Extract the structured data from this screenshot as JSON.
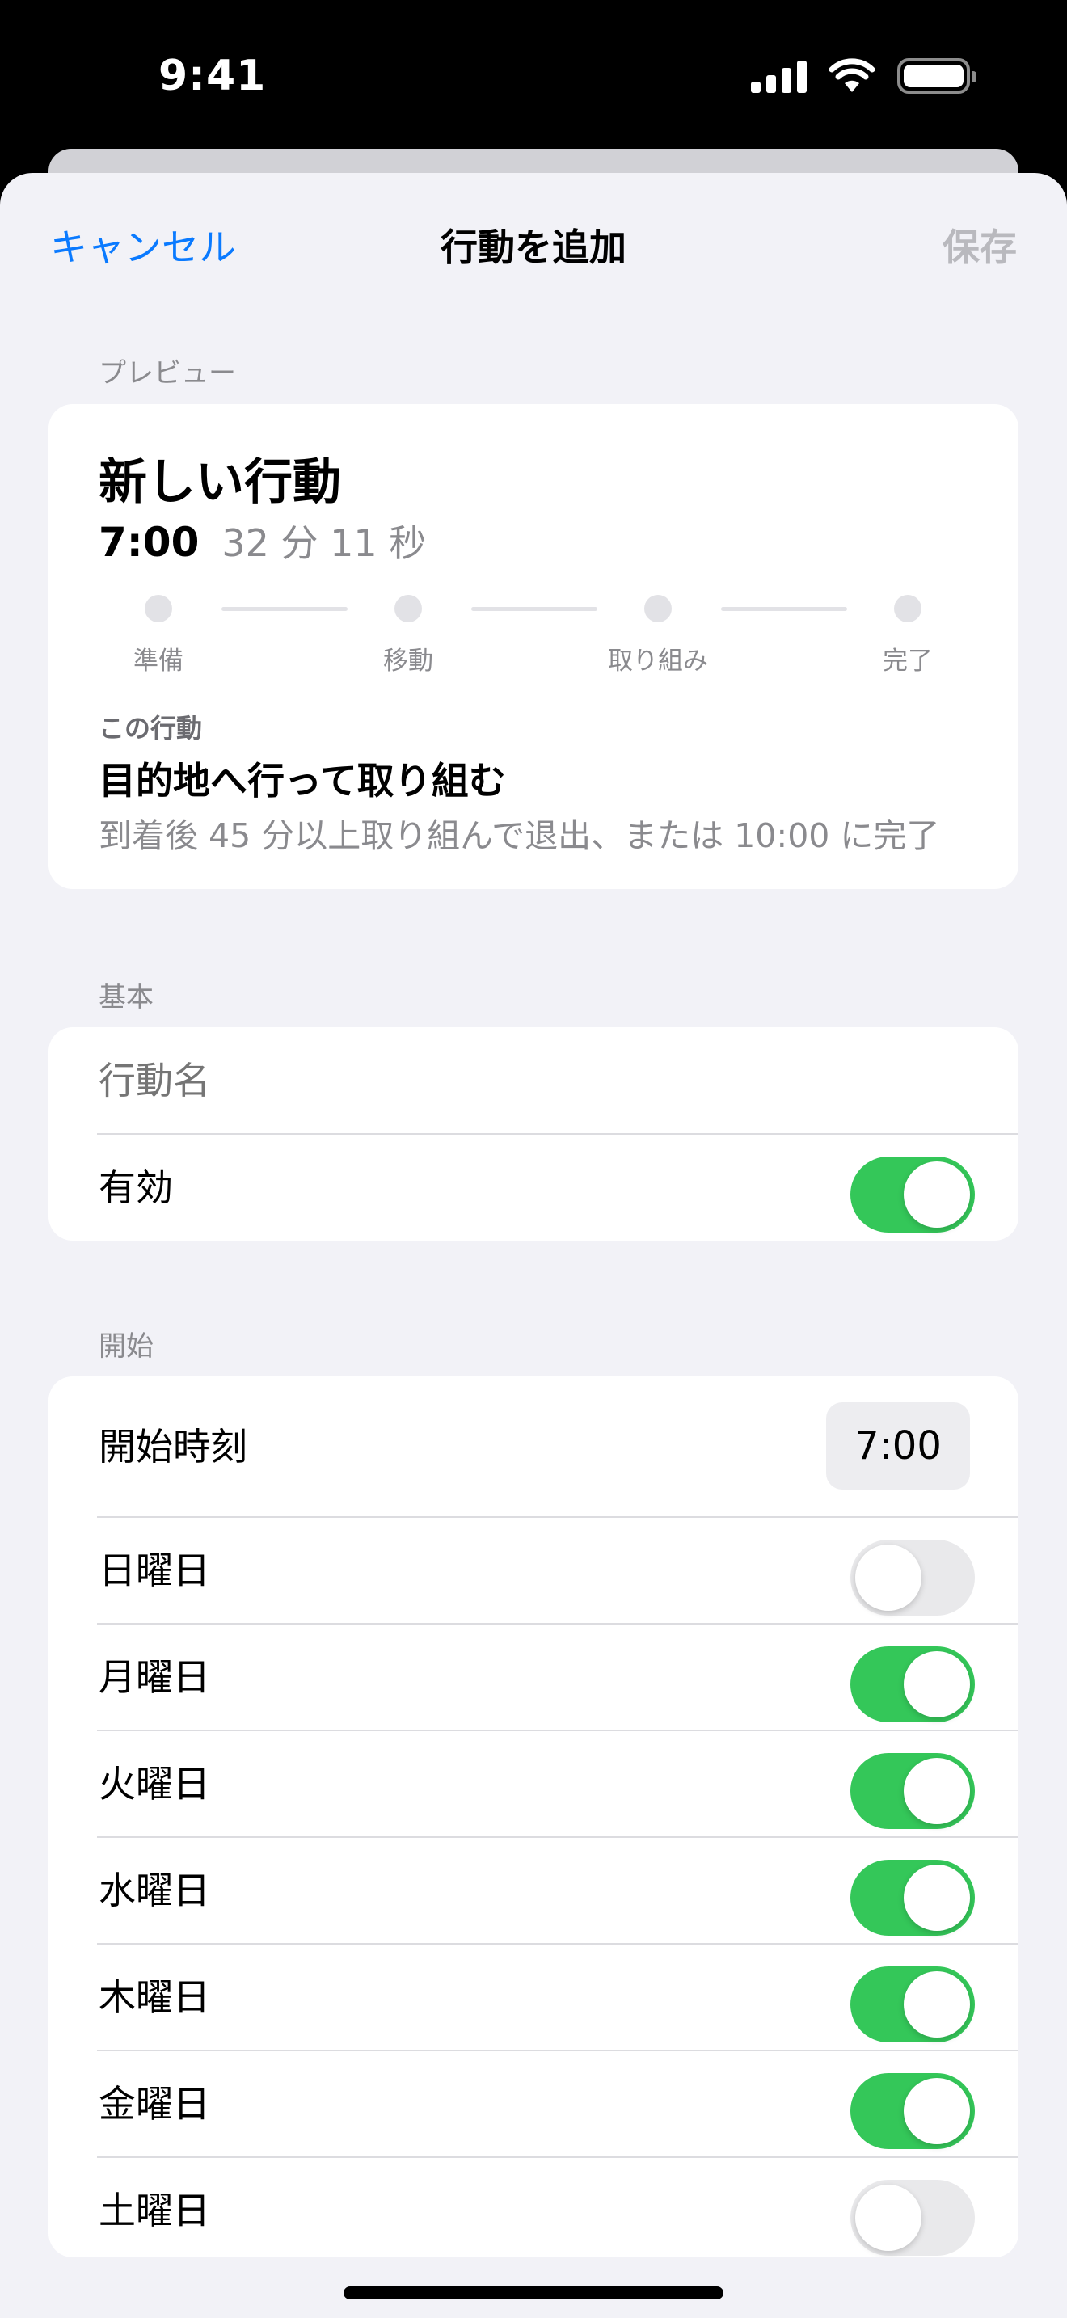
{
  "status_bar": {
    "time": "9:41",
    "icons": [
      "signal-icon",
      "wifi-icon",
      "battery-icon"
    ]
  },
  "nav": {
    "cancel": "キャンセル",
    "title": "行動を追加",
    "save": "保存"
  },
  "preview": {
    "header": "プレビュー",
    "title": "新しい行動",
    "time": "7:00",
    "duration": "32 分 11 秒",
    "timeline": [
      "準備",
      "移動",
      "取り組み",
      "完了"
    ],
    "caption": "この行動",
    "heading": "目的地へ行って取り組む",
    "description": "到着後 45 分以上取り組んで退出、または 10:00 に完了"
  },
  "basic": {
    "header": "基本",
    "name_placeholder": "行動名",
    "enabled_label": "有効",
    "enabled": true
  },
  "start": {
    "header": "開始",
    "start_time_label": "開始時刻",
    "start_time": "7:00",
    "days": [
      {
        "label": "日曜日",
        "on": false
      },
      {
        "label": "月曜日",
        "on": true
      },
      {
        "label": "火曜日",
        "on": true
      },
      {
        "label": "水曜日",
        "on": true
      },
      {
        "label": "木曜日",
        "on": true
      },
      {
        "label": "金曜日",
        "on": true
      },
      {
        "label": "土曜日",
        "on": false
      }
    ]
  },
  "colors": {
    "accent": "#0a7aff",
    "toggle_on": "#34c759",
    "toggle_off": "#e9e9eb",
    "background": "#f2f2f7"
  }
}
